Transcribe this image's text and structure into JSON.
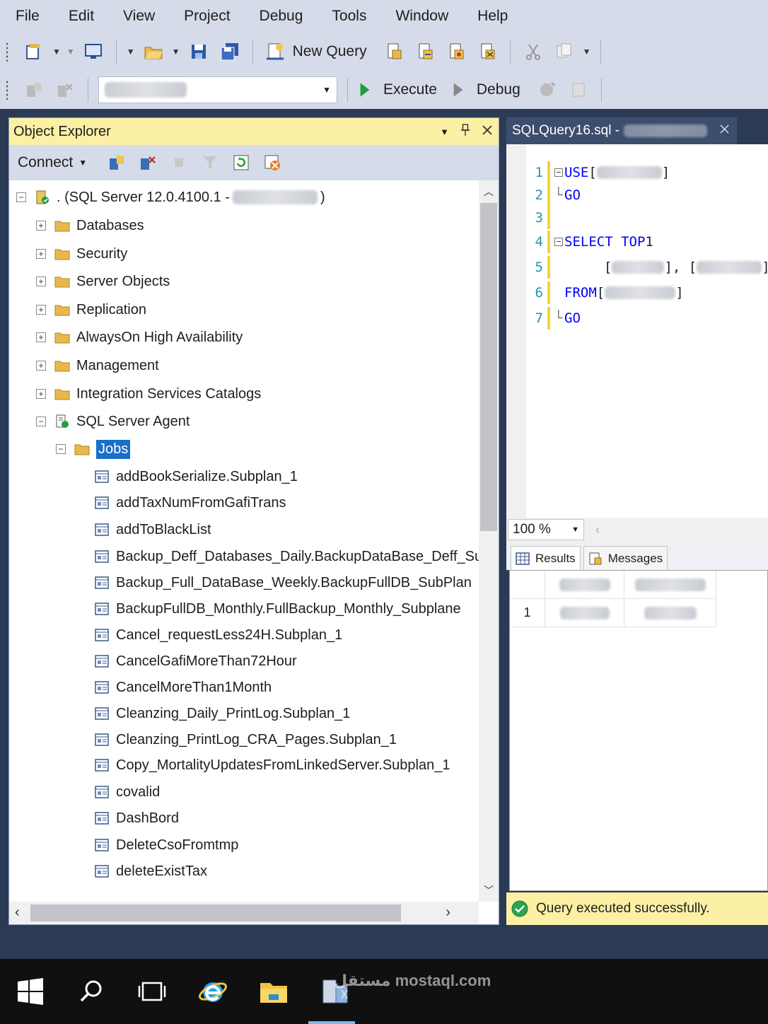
{
  "menu": [
    "File",
    "Edit",
    "View",
    "Project",
    "Debug",
    "Tools",
    "Window",
    "Help"
  ],
  "toolbar": {
    "new_query_label": "New Query",
    "execute_label": "Execute",
    "debug_label": "Debug"
  },
  "object_explorer": {
    "title": "Object Explorer",
    "connect_label": "Connect",
    "server_prefix": ". (SQL Server 12.0.4100.1 - ",
    "server_suffix": ")",
    "folders": [
      "Databases",
      "Security",
      "Server Objects",
      "Replication",
      "AlwaysOn High Availability",
      "Management",
      "Integration Services Catalogs"
    ],
    "agent_label": "SQL Server Agent",
    "jobs_label": "Jobs",
    "jobs": [
      "addBookSerialize.Subplan_1",
      "addTaxNumFromGafiTrans",
      "addToBlackList",
      "Backup_Deff_Databases_Daily.BackupDataBase_Deff_SubPlane",
      "Backup_Full_DataBase_Weekly.BackupFullDB_SubPlan",
      "BackupFullDB_Monthly.FullBackup_Monthly_Subplane",
      "Cancel_requestLess24H.Subplan_1",
      "CancelGafiMoreThan72Hour",
      "CancelMoreThan1Month",
      "Cleanzing_Daily_PrintLog.Subplan_1",
      "Cleanzing_PrintLog_CRA_Pages.Subplan_1",
      "Copy_MortalityUpdatesFromLinkedServer.Subplan_1",
      "covalid",
      "DashBord",
      "DeleteCsoFromtmp",
      "deleteExistTax"
    ]
  },
  "query": {
    "tab_title": "SQLQuery16.sql -",
    "lines": [
      {
        "num": "1",
        "kw": "USE",
        "rest": " ["
      },
      {
        "num": "2",
        "kw": "GO",
        "rest": ""
      },
      {
        "num": "3",
        "kw": "",
        "rest": ""
      },
      {
        "num": "4",
        "kw": "SELECT TOP",
        "rest": " 1"
      },
      {
        "num": "5",
        "kw": "",
        "rest": "["
      },
      {
        "num": "6",
        "kw": "FROM",
        "rest": " ["
      },
      {
        "num": "7",
        "kw": "GO",
        "rest": ""
      }
    ],
    "zoom": "100 %",
    "results_tab": "Results",
    "messages_tab": "Messages",
    "row_number": "1",
    "status": "Query executed successfully."
  },
  "colors": {
    "accent": "#1770c9",
    "panel_title": "#fcf0a4",
    "chrome": "#d6dbe9",
    "keyword": "#0000ff"
  },
  "watermark": "مستقل mostaql.com"
}
